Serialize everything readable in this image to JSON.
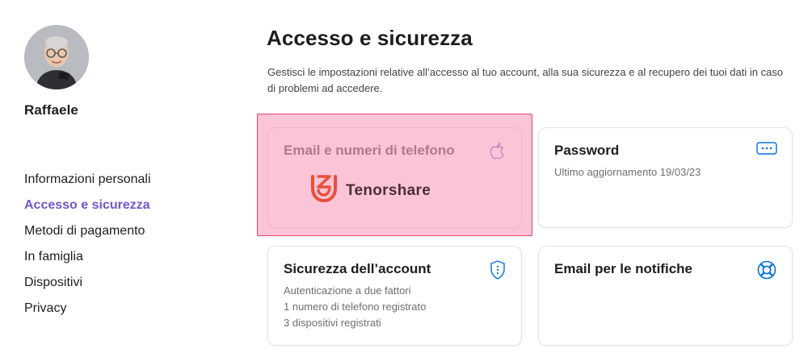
{
  "user": {
    "name": "Raffaele"
  },
  "sidebar": {
    "items": [
      {
        "label": "Informazioni personali"
      },
      {
        "label": "Accesso e sicurezza"
      },
      {
        "label": "Metodi di pagamento"
      },
      {
        "label": "In famiglia"
      },
      {
        "label": "Dispositivi"
      },
      {
        "label": "Privacy"
      }
    ],
    "active_index": 1
  },
  "main": {
    "title": "Accesso e sicurezza",
    "description": "Gestisci le impostazioni relative all’accesso al tuo account, alla sua sicurezza e al recupero dei tuoi dati in caso di problemi ad accedere.",
    "cards": {
      "email": {
        "title": "Email e numeri di telefono",
        "icon": "apple-icon"
      },
      "password": {
        "title": "Password",
        "lines": [
          "Ultimo aggiornamento 19/03/23"
        ],
        "icon": "password-dots-icon"
      },
      "security": {
        "title": "Sicurezza dell’account",
        "lines": [
          "Autenticazione a due fattori",
          "1 numero di telefono registrato",
          "3 dispositivi registrati"
        ],
        "icon": "shield-icon"
      },
      "notifications": {
        "title": "Email per le notifiche",
        "icon": "lifebuoy-icon"
      }
    }
  },
  "watermark": {
    "text": "Tenorshare"
  },
  "colors": {
    "accent": "#6f58c9",
    "icon_blue": "#0071e3",
    "highlight_fill": "#f8a0be",
    "highlight_border": "#e4426f",
    "watermark_red": "#e8503a"
  }
}
